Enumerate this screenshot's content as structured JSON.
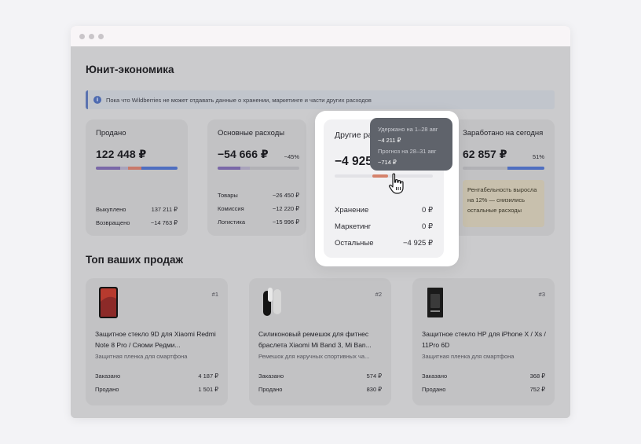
{
  "page_title": "Юнит-экономика",
  "info_banner": {
    "icon": "info-icon",
    "icon_glyph": "i",
    "text": "Пока что Wildberries не может отдавать данные о хранении, маркетинге и части других расходов"
  },
  "cards": {
    "sold": {
      "label": "Продано",
      "value": "122 448 ₽",
      "rows": [
        {
          "label": "Выкуплено",
          "value": "137 211 ₽"
        },
        {
          "label": "Возвращено",
          "value": "−14 763 ₽"
        }
      ]
    },
    "main_expenses": {
      "label": "Основные расходы",
      "value": "−54 666 ₽",
      "percent": "−45%",
      "rows": [
        {
          "label": "Товары",
          "value": "−26 450 ₽"
        },
        {
          "label": "Комиссия",
          "value": "−12 220 ₽"
        },
        {
          "label": "Логистика",
          "value": "−15 996 ₽"
        }
      ]
    },
    "other_expenses": {
      "label": "Другие расходы",
      "value": "−4 925 ₽",
      "rows": [
        {
          "label": "Хранение",
          "value": "0 ₽"
        },
        {
          "label": "Маркетинг",
          "value": "0 ₽"
        },
        {
          "label": "Остальные",
          "value": "−4 925 ₽"
        }
      ]
    },
    "earned_today": {
      "label": "Заработано на сегодня",
      "value": "62 857 ₽",
      "percent": "51%",
      "note": "Рентабельность выросла на 12% — снизились остальные расходы"
    }
  },
  "tooltip": {
    "held_label": "Удержано на 1–28 авг",
    "held_value": "−4 211 ₽",
    "forecast_label": "Прогноз на 28–31 авг",
    "forecast_value": "−714 ₽"
  },
  "section_title": "Топ ваших продаж",
  "products": [
    {
      "rank": "#1",
      "name": "Защитное стекло 9D для Xiaomi Redmi Note 8 Pro / Сяоми Редми...",
      "category": "Защитная пленка для смартфона",
      "ordered_label": "Заказано",
      "ordered": "4 187 ₽",
      "sold_label": "Продано",
      "sold": "1 501 ₽"
    },
    {
      "rank": "#2",
      "name": "Силиконовый ремешок для фитнес браслета Xiaomi Mi Band 3, Mi Ban...",
      "category": "Ремешок для наручных спортивных ча...",
      "ordered_label": "Заказано",
      "ordered": "574 ₽",
      "sold_label": "Продано",
      "sold": "830 ₽"
    },
    {
      "rank": "#3",
      "name": "Защитное стекло HP для iPhone X / Xs / 11Pro 6D",
      "category": "Защитная пленка для смартфона",
      "ordered_label": "Заказано",
      "ordered": "368 ₽",
      "sold_label": "Продано",
      "sold": "752 ₽"
    }
  ],
  "colors": {
    "purple": "#7a68a8",
    "coral": "#c9796a",
    "blue": "#4f6ec0",
    "highlight_coral": "#d5826b",
    "info_accent": "#4d6ab0"
  }
}
